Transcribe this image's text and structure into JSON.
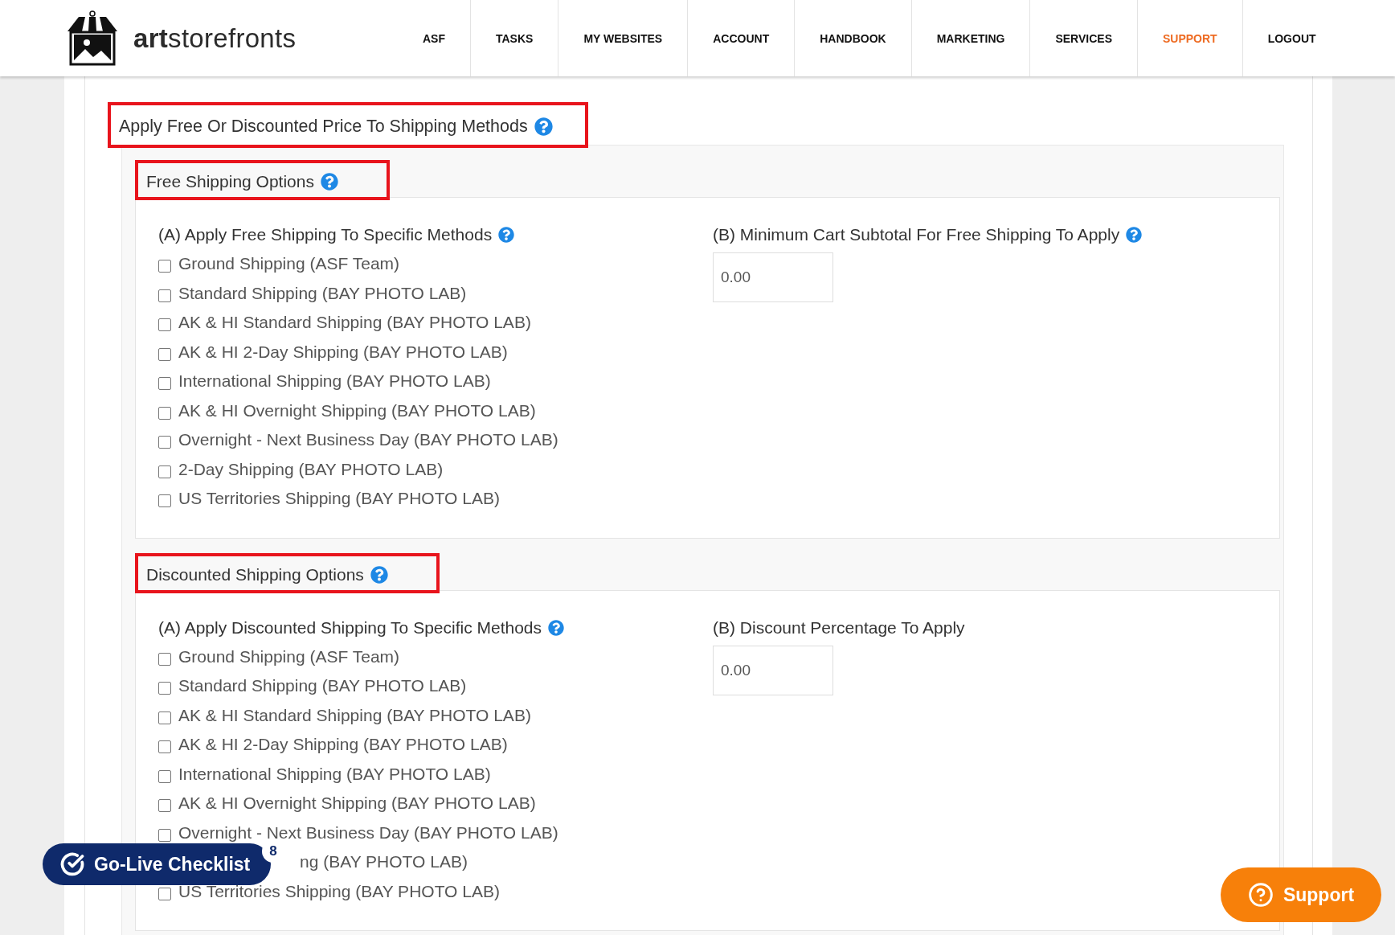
{
  "header": {
    "brand": "**art**storefronts",
    "nav": [
      {
        "label": "ASF",
        "selected": false
      },
      {
        "label": "TASKS",
        "selected": false
      },
      {
        "label": "MY WEBSITES",
        "selected": false
      },
      {
        "label": "ACCOUNT",
        "selected": false
      },
      {
        "label": "HANDBOOK",
        "selected": false
      },
      {
        "label": "MARKETING",
        "selected": false
      },
      {
        "label": "SERVICES",
        "selected": false
      },
      {
        "label": "SUPPORT",
        "selected": true
      },
      {
        "label": "LOGOUT",
        "selected": false
      }
    ]
  },
  "section": {
    "title": "Apply Free Or Discounted Price To Shipping Methods",
    "highlighted": true,
    "help": true,
    "groups": [
      {
        "title": "Free Shipping Options",
        "highlighted": true,
        "help": true,
        "methods_heading": "(A) Apply Free Shipping To Specific Methods",
        "methods_help": true,
        "methods": [
          {
            "kind": "checkbox",
            "label": "Ground Shipping (ASF Team)",
            "checked": false
          },
          {
            "kind": "checkbox",
            "label": "Standard Shipping (BAY PHOTO LAB)",
            "checked": false
          },
          {
            "kind": "checkbox",
            "label": "AK & HI Standard Shipping (BAY PHOTO LAB)",
            "checked": false
          },
          {
            "kind": "checkbox",
            "label": "AK & HI 2-Day Shipping (BAY PHOTO LAB)",
            "checked": false
          },
          {
            "kind": "checkbox",
            "label": "International Shipping (BAY PHOTO LAB)",
            "checked": false
          },
          {
            "kind": "checkbox",
            "label": "AK & HI Overnight Shipping (BAY PHOTO LAB)",
            "checked": false
          },
          {
            "kind": "checkbox",
            "label": "Overnight - Next Business Day (BAY PHOTO LAB)",
            "checked": false
          },
          {
            "kind": "checkbox",
            "label": "2-Day Shipping (BAY PHOTO LAB)",
            "checked": false
          },
          {
            "kind": "checkbox",
            "label": "US Territories Shipping (BAY PHOTO LAB)",
            "checked": false
          }
        ],
        "amount_heading": "(B) Minimum Cart Subtotal For Free Shipping To Apply",
        "amount_help": true,
        "amount_value": "0.00"
      },
      {
        "title": "Discounted Shipping Options",
        "highlighted": true,
        "help": true,
        "methods_heading": "(A) Apply Discounted Shipping To Specific Methods",
        "methods_help": true,
        "methods": [
          {
            "kind": "checkbox",
            "label": "Ground Shipping (ASF Team)",
            "checked": false
          },
          {
            "kind": "checkbox",
            "label": "Standard Shipping (BAY PHOTO LAB)",
            "checked": false
          },
          {
            "kind": "checkbox",
            "label": "AK & HI Standard Shipping (BAY PHOTO LAB)",
            "checked": false
          },
          {
            "kind": "checkbox",
            "label": "AK & HI 2-Day Shipping (BAY PHOTO LAB)",
            "checked": false
          },
          {
            "kind": "checkbox",
            "label": "International Shipping (BAY PHOTO LAB)",
            "checked": false
          },
          {
            "kind": "checkbox",
            "label": "AK & HI Overnight Shipping (BAY PHOTO LAB)",
            "checked": false
          },
          {
            "kind": "checkbox",
            "label": "Overnight - Next Business Day (BAY PHOTO LAB)",
            "checked": false
          },
          {
            "kind": "covered",
            "label": "ng (BAY PHOTO LAB)"
          },
          {
            "kind": "checkbox",
            "label": "US Territories Shipping (BAY PHOTO LAB)",
            "checked": false
          }
        ],
        "amount_heading": "(B) Discount Percentage To Apply",
        "amount_help": false,
        "amount_value": "0.00"
      }
    ]
  },
  "checklist_button": {
    "label": "Go-Live Checklist",
    "badge": "8"
  },
  "support_button": {
    "label": "Support"
  }
}
